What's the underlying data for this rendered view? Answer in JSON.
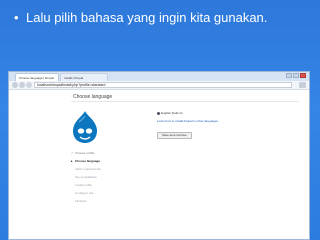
{
  "slide": {
    "bullet_symbol": "•",
    "bullet_text": "Lalu pilih bahasa yang ingin kita gunakan."
  },
  "browser": {
    "tabs": [
      {
        "label": "Choose language | Drupal"
      },
      {
        "label": "Install | Drupal"
      }
    ],
    "url": "localhost/drupal/install.php?profile=standard"
  },
  "installer": {
    "page_title": "Choose language",
    "steps": [
      {
        "label": "Choose profile",
        "state": "done"
      },
      {
        "label": "Choose language",
        "state": "active"
      },
      {
        "label": "Verify requirements",
        "state": "todo"
      },
      {
        "label": "Set up database",
        "state": "todo"
      },
      {
        "label": "Install profile",
        "state": "todo"
      },
      {
        "label": "Configure site",
        "state": "todo"
      },
      {
        "label": "Finished",
        "state": "todo"
      }
    ],
    "language_option": "English (built-in)",
    "link_text": "Learn how to install Drupal in other languages",
    "button_label": "Save and continue"
  },
  "colors": {
    "slide_background": "#2d78da",
    "drupal_blue": "#0c76bf",
    "link": "#1b5fb8"
  }
}
